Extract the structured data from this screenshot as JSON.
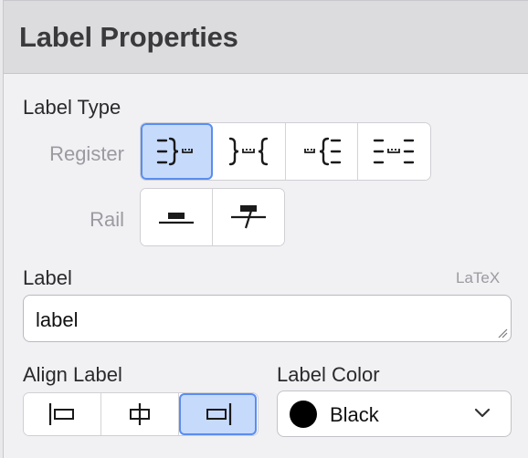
{
  "panel": {
    "title": "Label Properties"
  },
  "label_type": {
    "heading": "Label Type",
    "register_label": "Register",
    "rail_label": "Rail",
    "register_options": [
      {
        "icon": "register-label-right-icon",
        "selected": true
      },
      {
        "icon": "register-label-center-icon",
        "selected": false
      },
      {
        "icon": "register-label-left-icon",
        "selected": false
      },
      {
        "icon": "register-label-both-icon",
        "selected": false
      }
    ],
    "rail_options": [
      {
        "icon": "rail-label-icon",
        "selected": false
      },
      {
        "icon": "rail-label-strike-icon",
        "selected": false
      }
    ]
  },
  "label": {
    "heading": "Label",
    "latex_hint": "LaTeX",
    "value": "label"
  },
  "align_label": {
    "heading": "Align Label",
    "options": [
      {
        "icon": "align-left-icon",
        "selected": false
      },
      {
        "icon": "align-center-icon",
        "selected": false
      },
      {
        "icon": "align-right-icon",
        "selected": true
      }
    ]
  },
  "label_color": {
    "heading": "Label Color",
    "value": "Black",
    "swatch": "#000000"
  },
  "colors": {
    "selected_fill": "#c6dafc",
    "selected_border": "#5a8dee"
  }
}
